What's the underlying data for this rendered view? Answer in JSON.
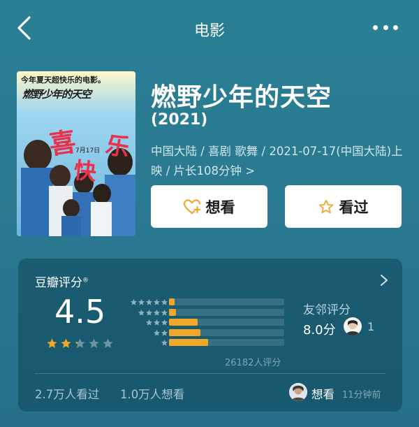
{
  "nav": {
    "title": "电影",
    "icons": {
      "back": "chevron-left-icon",
      "more": "more-dots-icon"
    }
  },
  "movie": {
    "title": "燃野少年的天空",
    "year": "(2021)",
    "meta": "中国大陆 / 喜剧 歌舞 / 2021-07-17(中国大陆)上映 / 片长108分钟 >",
    "poster": {
      "tagline": "今年夏天超快乐的电影。",
      "title_art": "燃野少年的天空",
      "release": "7月17日",
      "big_char_1": "喜",
      "big_char_2": "快",
      "big_char_3": "乐"
    }
  },
  "actions": {
    "want_label": "想看",
    "seen_label": "看过"
  },
  "rating": {
    "header": "豆瓣评分",
    "header_mark": "®",
    "score": "4.5",
    "star_fraction": 0.45,
    "distribution": [
      {
        "stars": 5,
        "percent": 0.05
      },
      {
        "stars": 4,
        "percent": 0.06
      },
      {
        "stars": 3,
        "percent": 0.25
      },
      {
        "stars": 2,
        "percent": 0.27
      },
      {
        "stars": 1,
        "percent": 0.34
      }
    ],
    "total": "26182人评分",
    "friends_label": "友邻评分",
    "friends_score": "8.0分",
    "friends_count": "1",
    "seen_count": "2.7万人看过",
    "want_count": "1.0万人想看",
    "activity_action": "想看",
    "activity_time": "11分钟前"
  },
  "colors": {
    "background": "#2a7f95",
    "accent": "#f2a72b",
    "card": "#1a5567"
  }
}
